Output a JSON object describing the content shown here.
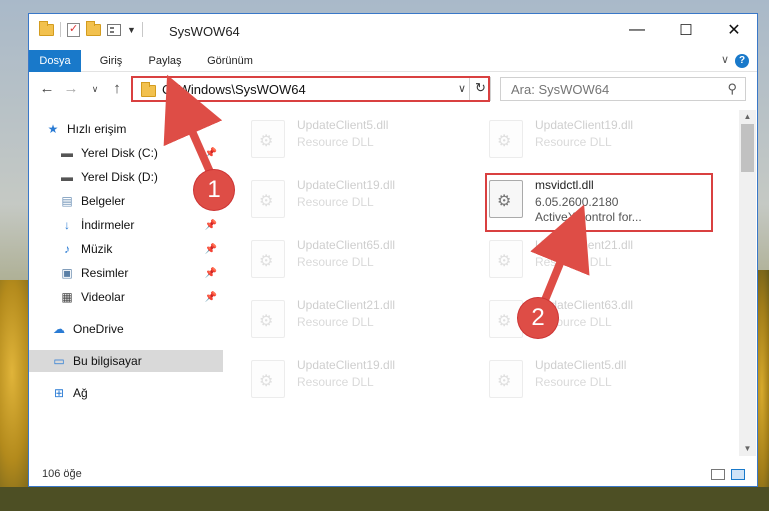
{
  "window": {
    "title": "SysWOW64",
    "controls": {
      "minimize": "—",
      "maximize": "☐",
      "close": "✕"
    }
  },
  "ribbon": {
    "tabs": [
      {
        "label": "Dosya",
        "active": true
      },
      {
        "label": "Giriş",
        "active": false
      },
      {
        "label": "Paylaş",
        "active": false
      },
      {
        "label": "Görünüm",
        "active": false
      }
    ],
    "help": "?"
  },
  "navigation": {
    "address": "C:\\Windows\\SysWOW64",
    "search_placeholder": "Ara: SysWOW64"
  },
  "sidebar": {
    "items": [
      {
        "label": "Hızlı erişim",
        "icon": "star-icon"
      },
      {
        "label": "Yerel Disk (C:)",
        "icon": "drive-icon",
        "pinned": true
      },
      {
        "label": "Yerel Disk (D:)",
        "icon": "drive-icon",
        "pinned": true
      },
      {
        "label": "Belgeler",
        "icon": "documents-icon",
        "pinned": true
      },
      {
        "label": "İndirmeler",
        "icon": "download-icon",
        "pinned": true
      },
      {
        "label": "Müzik",
        "icon": "music-icon",
        "pinned": true
      },
      {
        "label": "Resimler",
        "icon": "pictures-icon",
        "pinned": true
      },
      {
        "label": "Videolar",
        "icon": "video-icon",
        "pinned": true
      },
      {
        "label": "OneDrive",
        "icon": "cloud-icon"
      },
      {
        "label": "Bu bilgisayar",
        "icon": "computer-icon",
        "selected": true
      },
      {
        "label": "Ağ",
        "icon": "network-icon"
      }
    ]
  },
  "files": [
    {
      "name": "UpdateClient5.dll",
      "type": "Resource DLL"
    },
    {
      "name": "UpdateClient19.dll",
      "type": "Resource DLL"
    },
    {
      "name": "UpdateClient19.dll",
      "type": "Resource DLL"
    },
    {
      "name": "msvidctl.dll",
      "version": "6.05.2600.2180",
      "description": "ActiveX control for...",
      "highlighted": true
    },
    {
      "name": "UpdateClient65.dll",
      "type": "Resource DLL"
    },
    {
      "name": "UpdateClient21.dll",
      "type": "Resource DLL"
    },
    {
      "name": "UpdateClient21.dll",
      "type": "Resource DLL"
    },
    {
      "name": "UpdateClient63.dll",
      "type": "Resource DLL"
    },
    {
      "name": "UpdateClient19.dll",
      "type": "Resource DLL"
    },
    {
      "name": "UpdateClient5.dll",
      "type": "Resource DLL"
    }
  ],
  "status": {
    "item_count": "106 öğe"
  },
  "callouts": [
    "1",
    "2"
  ],
  "colors": {
    "accent": "#1979ca",
    "highlight_box": "#d94040",
    "callout": "#de4d46"
  }
}
